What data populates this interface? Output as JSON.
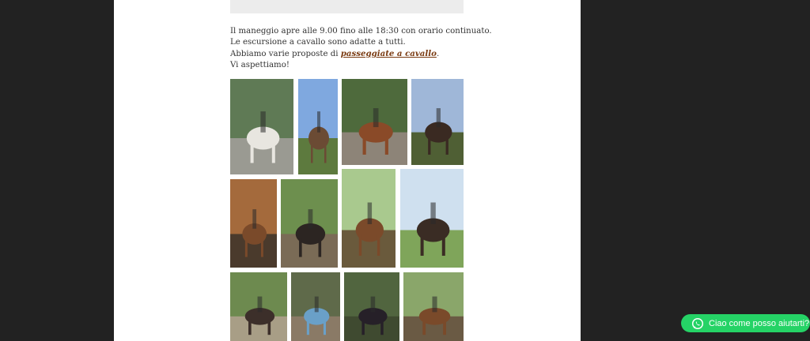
{
  "content": {
    "lines": [
      "Il maneggio apre alle 9.00 fino alle 18:30 con orario continuato.",
      "Le escursione a cavallo sono adatte a tutti."
    ],
    "line3_prefix": "Abbiamo varie proposte di",
    "line3_link": "passeggiate a cavallo",
    "line3_suffix": ".",
    "line4": "Vi aspettiamo!"
  },
  "gallery": {
    "photos": [
      {
        "name": "photo-man-leading-white-horse",
        "sky": "#5f7a55",
        "ground": "#9a9a92",
        "subject": "#e8e6e0"
      },
      {
        "name": "photo-horse-field-blue-sky",
        "sky": "#7fa8df",
        "ground": "#5d7a3e",
        "subject": "#6b4b34"
      },
      {
        "name": "photo-chestnut-horse-forest",
        "sky": "#4e6a3c",
        "ground": "#8d8478",
        "subject": "#8a4a28"
      },
      {
        "name": "photo-rider-dark-horse-trees",
        "sky": "#9fb7d8",
        "ground": "#4f5f34",
        "subject": "#3a2a22"
      },
      {
        "name": "photo-horse-head-stable",
        "sky": "#a46a3c",
        "ground": "#4a3a2c",
        "subject": "#7a4a2a"
      },
      {
        "name": "photo-horses-wooden-shelter",
        "sky": "#6d8f4e",
        "ground": "#7a6b56",
        "subject": "#2c2522"
      },
      {
        "name": "photo-rider-forest-trail",
        "sky": "#a9c98e",
        "ground": "#6a5a3c",
        "subject": "#7b4a2a"
      },
      {
        "name": "photo-riders-green-meadow",
        "sky": "#cfe0ef",
        "ground": "#7fa55a",
        "subject": "#3a2c24"
      },
      {
        "name": "photo-riders-wooded-hill",
        "sky": "#6d8a4f",
        "ground": "#a89e86",
        "subject": "#3c2f2a"
      },
      {
        "name": "photo-child-petting-horse",
        "sky": "#5f6a4a",
        "ground": "#8a7a66",
        "subject": "#6aa0c8"
      },
      {
        "name": "photo-riders-dark-forest",
        "sky": "#51653f",
        "ground": "#3f4a30",
        "subject": "#262028"
      },
      {
        "name": "photo-horses-tied-woods",
        "sky": "#8aa66a",
        "ground": "#6a5a44",
        "subject": "#7a4a2a"
      }
    ]
  },
  "whatsapp": {
    "label": "Ciao come posso aiutarti?",
    "color": "#25d366",
    "icon": "whatsapp-icon"
  },
  "colors": {
    "background": "#222222",
    "page": "#ffffff",
    "link": "#7a3b12"
  }
}
